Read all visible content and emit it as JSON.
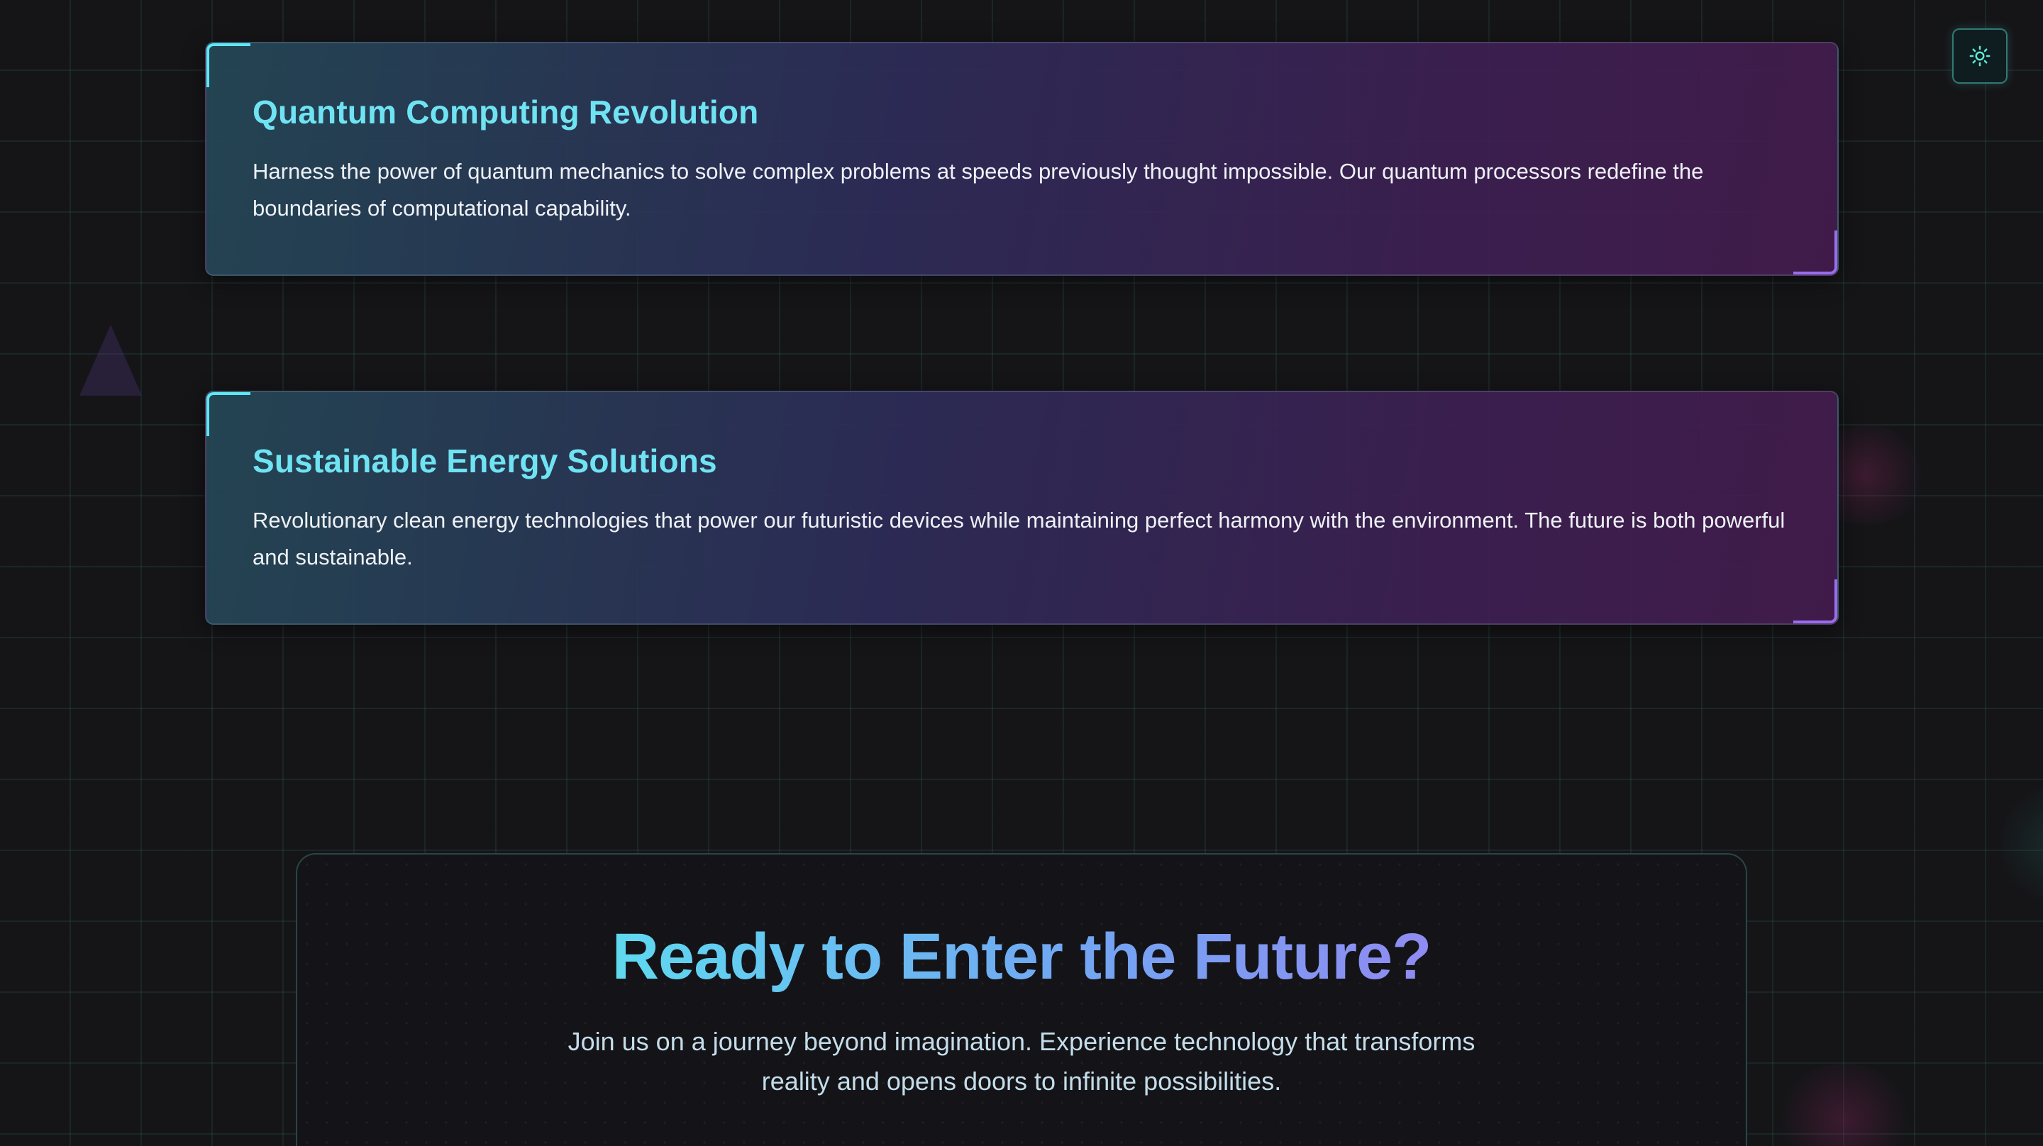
{
  "theme_toggle": {
    "icon": "sun-icon",
    "accent": "#5eead4"
  },
  "cards": [
    {
      "title": "Quantum Computing Revolution",
      "text": "Harness the power of quantum mechanics to solve complex problems at speeds previously thought impossible. Our quantum processors redefine the boundaries of computational capability."
    },
    {
      "title": "Sustainable Energy Solutions",
      "text": "Revolutionary clean energy technologies that power our futuristic devices while maintaining perfect harmony with the environment. The future is both powerful and sustainable."
    }
  ],
  "cta": {
    "title": "Ready to Enter the Future?",
    "text": "Join us on a journey beyond imagination. Experience technology that transforms reality and opens doors to infinite possibilities."
  },
  "colors": {
    "background": "#151518",
    "card_title": "#6fe3f2",
    "corner_accent_top": "#5ee7f5",
    "corner_accent_bottom": "#9a6cf0",
    "cta_gradient_start": "#5fd9f0",
    "cta_gradient_end": "#8f8bf2"
  }
}
